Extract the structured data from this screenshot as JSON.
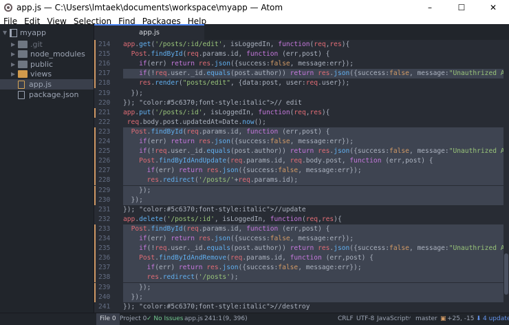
{
  "window": {
    "title": "app.js — C:\\Users\\lmtaek\\documents\\workspace\\myapp — Atom",
    "controls": [
      "–",
      "☐",
      "✕"
    ]
  },
  "menu": [
    "File",
    "Edit",
    "View",
    "Selection",
    "Find",
    "Packages",
    "Help"
  ],
  "tree": {
    "root": "myapp",
    "items": [
      {
        "label": ".git",
        "kind": "folder",
        "muted": true
      },
      {
        "label": "node_modules",
        "kind": "folder",
        "muted": false
      },
      {
        "label": "public",
        "kind": "folder",
        "muted": false
      },
      {
        "label": "views",
        "kind": "folder-yellow",
        "muted": false
      },
      {
        "label": "app.js",
        "kind": "file-js",
        "selected": true
      },
      {
        "label": "package.json",
        "kind": "file-json",
        "selected": false
      }
    ]
  },
  "tabs": [
    {
      "label": "app.js"
    }
  ],
  "editor": {
    "lines": [
      {
        "n": "214",
        "text": "app.get('/posts/:id/edit', isLoggedIn, function(req,res){",
        "mod": true,
        "sel": false
      },
      {
        "n": "215",
        "text": "  Post.findById(req.params.id, function (err,post) {",
        "mod": true,
        "sel": false
      },
      {
        "n": "216",
        "text": "    if(err) return res.json({success:false, message:err});",
        "mod": true,
        "sel": false
      },
      {
        "n": "217",
        "text": "    if(!req.user._id.equals(post.author)) return res.json({success:false, message:\"Unauthrized Attempt\"});",
        "mod": true,
        "sel": true
      },
      {
        "n": "218",
        "text": "    res.render(\"posts/edit\", {data:post, user:req.user});",
        "mod": true,
        "sel": false
      },
      {
        "n": "219",
        "text": "  });",
        "mod": false,
        "sel": false
      },
      {
        "n": "220",
        "text": "}); // edit",
        "mod": false,
        "sel": false
      },
      {
        "n": "221",
        "text": "app.put('/posts/:id', isLoggedIn, function(req,res){",
        "mod": true,
        "sel": false
      },
      {
        "n": "222",
        "text": " req.body.post.updatedAt=Date.now();",
        "mod": false,
        "sel": false
      },
      {
        "n": "223",
        "text": "  Post.findById(req.params.id, function (err,post) {",
        "mod": true,
        "sel": true
      },
      {
        "n": "224",
        "text": "    if(err) return res.json({success:false, message:err});",
        "mod": true,
        "sel": true
      },
      {
        "n": "225",
        "text": "    if(!req.user._id.equals(post.author)) return res.json({success:false, message:\"Unauthrized Attempt\"});",
        "mod": true,
        "sel": true
      },
      {
        "n": "226",
        "text": "    Post.findByIdAndUpdate(req.params.id, req.body.post, function (err,post) {",
        "mod": true,
        "sel": true
      },
      {
        "n": "227",
        "text": "      if(err) return res.json({success:false, message:err});",
        "mod": true,
        "sel": true
      },
      {
        "n": "228",
        "text": "      res.redirect('/posts/'+req.params.id);",
        "mod": true,
        "sel": true
      },
      {
        "n": "229",
        "text": "    });",
        "mod": true,
        "sel": true
      },
      {
        "n": "230",
        "text": "  });",
        "mod": true,
        "sel": true
      },
      {
        "n": "231",
        "text": "}); //update",
        "mod": false,
        "sel": false
      },
      {
        "n": "232",
        "text": "app.delete('/posts/:id', isLoggedIn, function(req,res){",
        "mod": false,
        "sel": false
      },
      {
        "n": "233",
        "text": "  Post.findById(req.params.id, function (err,post) {",
        "mod": true,
        "sel": true
      },
      {
        "n": "234",
        "text": "    if(err) return res.json({success:false, message:err});",
        "mod": true,
        "sel": true
      },
      {
        "n": "235",
        "text": "    if(!req.user._id.equals(post.author)) return res.json({success:false, message:\"Unauthrized Attempt\"});",
        "mod": true,
        "sel": true
      },
      {
        "n": "236",
        "text": "    Post.findByIdAndRemove(req.params.id, function (err,post) {",
        "mod": true,
        "sel": true
      },
      {
        "n": "237",
        "text": "      if(err) return res.json({success:false, message:err});",
        "mod": true,
        "sel": true
      },
      {
        "n": "238",
        "text": "      res.redirect('/posts');",
        "mod": true,
        "sel": true
      },
      {
        "n": "239",
        "text": "    });",
        "mod": true,
        "sel": true
      },
      {
        "n": "240",
        "text": "  });",
        "mod": true,
        "sel": true
      },
      {
        "n": "241",
        "text": "}); //destroy",
        "mod": false,
        "sel": false
      }
    ]
  },
  "status": {
    "file_tab": "File 0",
    "project_tab": "Project 0",
    "issues": "✓ No Issues",
    "filename": "app.js",
    "cursor": "241:1",
    "selection": "(9, 396)",
    "line_ending": "CRLF",
    "encoding": "UTF-8",
    "grammar": "JavaScript",
    "branch": "master",
    "diff": "+25, -15",
    "updates": "4 updates"
  }
}
